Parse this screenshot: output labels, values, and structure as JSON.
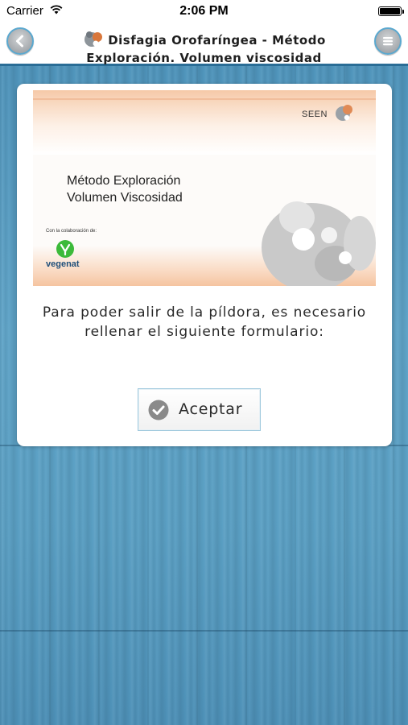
{
  "status_bar": {
    "carrier": "Carrier",
    "time": "2:06 PM"
  },
  "nav": {
    "title_line1": "Disfagia Orofaríngea - Método",
    "title_line2": "Exploración. Volumen viscosidad",
    "back_icon": "chevron-left-icon",
    "menu_icon": "hamburger-menu-icon"
  },
  "cover": {
    "seen_label": "SEEN",
    "title_line1": "Método Exploración",
    "title_line2": "Volumen Viscosidad",
    "collab_label": "Con la colaboración de:",
    "sponsor_name": "vegenat"
  },
  "dialog": {
    "message": "Para poder salir de la píldora, es necesario rellenar el siguiente formulario:",
    "accept_label": "Aceptar",
    "accept_icon": "checkmark-circle-icon"
  },
  "colors": {
    "accent": "#2a6d96",
    "background": "#5b9dc0",
    "brand_green": "#3cba3a"
  }
}
